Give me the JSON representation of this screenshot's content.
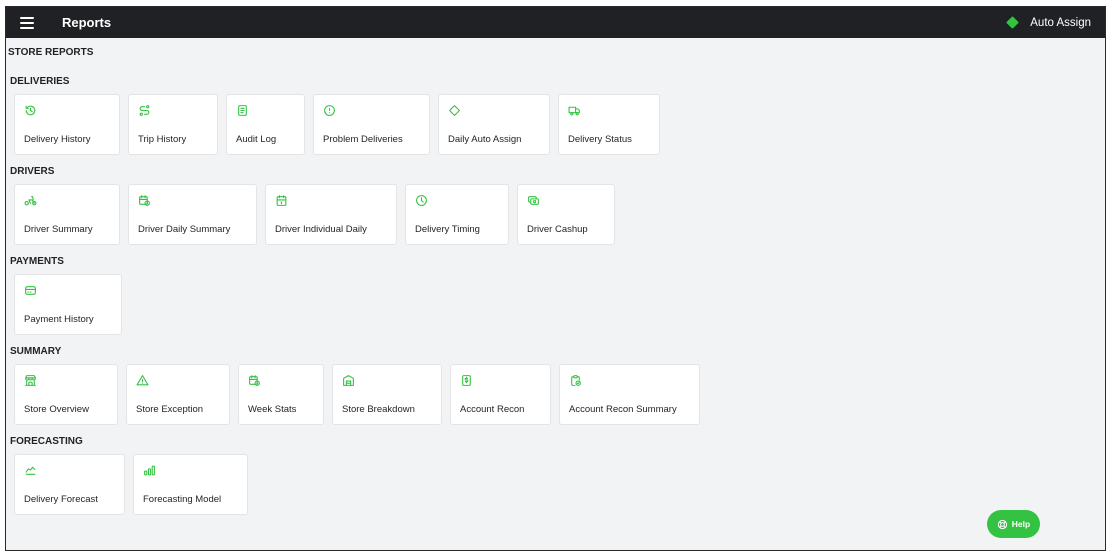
{
  "topbar": {
    "title": "Reports",
    "auto_assign_label": "Auto Assign"
  },
  "page": {
    "heading": "STORE REPORTS"
  },
  "colors": {
    "accent": "#34c242",
    "topbar": "#1f2125",
    "background": "#f2f3f4"
  },
  "sections": {
    "deliveries": {
      "title": "DELIVERIES",
      "cards": [
        {
          "label": "Delivery History",
          "icon": "history-icon"
        },
        {
          "label": "Trip History",
          "icon": "route-icon"
        },
        {
          "label": "Audit Log",
          "icon": "document-icon"
        },
        {
          "label": "Problem Deliveries",
          "icon": "alert-circle-icon"
        },
        {
          "label": "Daily Auto Assign",
          "icon": "diamond-icon"
        },
        {
          "label": "Delivery Status",
          "icon": "truck-icon"
        }
      ]
    },
    "drivers": {
      "title": "DRIVERS",
      "cards": [
        {
          "label": "Driver Summary",
          "icon": "bike-icon"
        },
        {
          "label": "Driver Daily Summary",
          "icon": "calendar-clock-icon"
        },
        {
          "label": "Driver Individual Daily",
          "icon": "calendar-icon"
        },
        {
          "label": "Delivery Timing",
          "icon": "clock-icon"
        },
        {
          "label": "Driver Cashup",
          "icon": "cash-icon"
        }
      ]
    },
    "payments": {
      "title": "PAYMENTS",
      "cards": [
        {
          "label": "Payment History",
          "icon": "credit-card-icon"
        }
      ]
    },
    "summary": {
      "title": "SUMMARY",
      "cards": [
        {
          "label": "Store Overview",
          "icon": "store-icon"
        },
        {
          "label": "Store Exception",
          "icon": "warning-icon"
        },
        {
          "label": "Week Stats",
          "icon": "calendar-stats-icon"
        },
        {
          "label": "Store Breakdown",
          "icon": "building-icon"
        },
        {
          "label": "Account Recon",
          "icon": "receipt-dollar-icon"
        },
        {
          "label": "Account Recon Summary",
          "icon": "clipboard-check-icon"
        }
      ]
    },
    "forecasting": {
      "title": "FORECASTING",
      "cards": [
        {
          "label": "Delivery Forecast",
          "icon": "trend-line-icon"
        },
        {
          "label": "Forecasting Model",
          "icon": "bar-chart-icon"
        }
      ]
    }
  },
  "help": {
    "label": "Help",
    "icon": "lifebuoy-icon"
  }
}
